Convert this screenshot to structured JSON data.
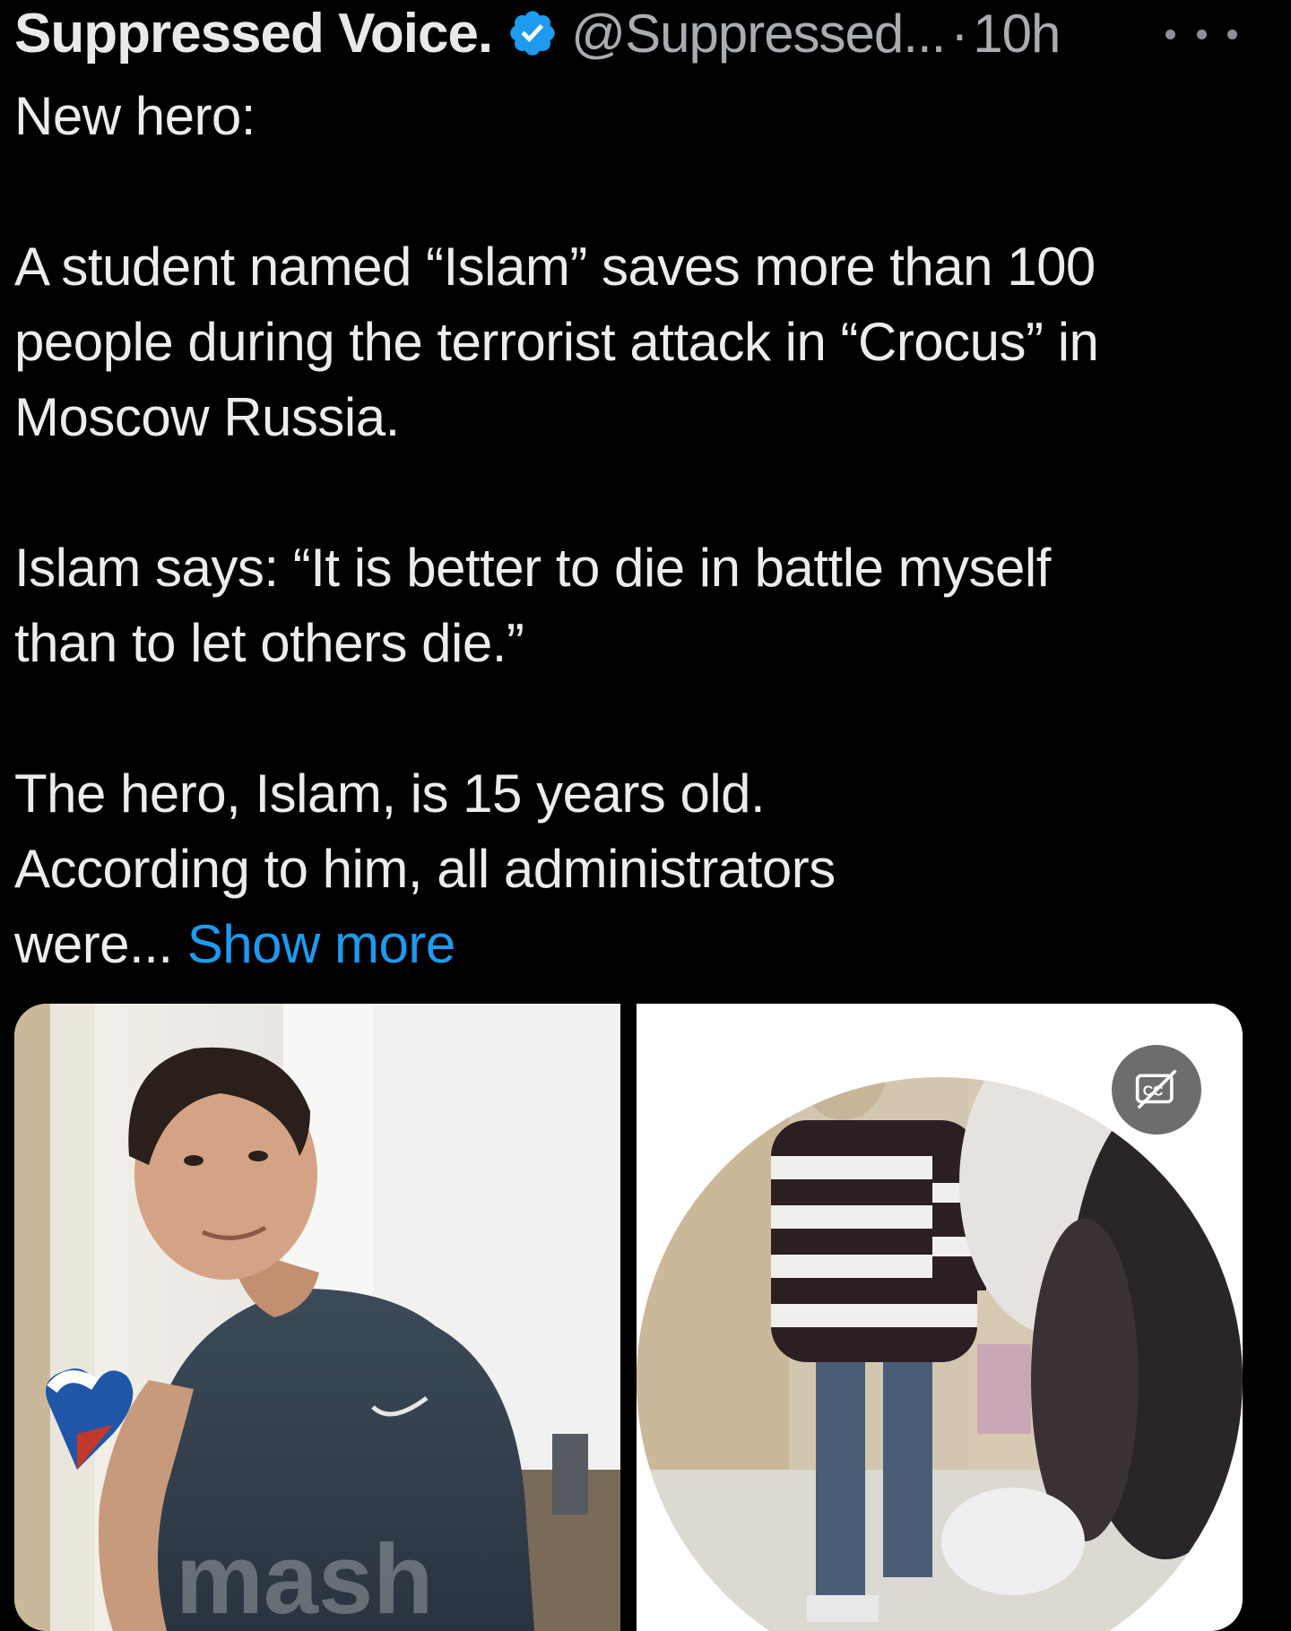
{
  "author": {
    "display_name": "Suppressed Voice.",
    "handle": "@Suppressed...",
    "separator": "·",
    "time": "10h",
    "verified_icon": "verified-badge-icon"
  },
  "post": {
    "line1": "New hero:",
    "para2_line1": "A student named “Islam” saves more than 100",
    "para2_line2": "people during the terrorist attack in “Crocus” in",
    "para2_line3": "Moscow Russia.",
    "para3_line1": "Islam says: “It is better to die in battle myself",
    "para3_line2": "than to let others die.”",
    "para4_line1": "The hero, Islam, is 15 years old.",
    "para4_line2": "According to him, all administrators",
    "para4_line3": "were... ",
    "show_more": "Show more"
  },
  "media": {
    "left_watermark": "mash",
    "left_icon": "photo-of-teen-boy",
    "right_icon": "video-frame-people-running",
    "cc_icon": "closed-captions-off-icon"
  },
  "colors": {
    "background": "#000000",
    "text": "#e7e9ea",
    "secondary": "#a9adb1",
    "link": "#1d9bf0",
    "verified": "#1d9bf0"
  }
}
